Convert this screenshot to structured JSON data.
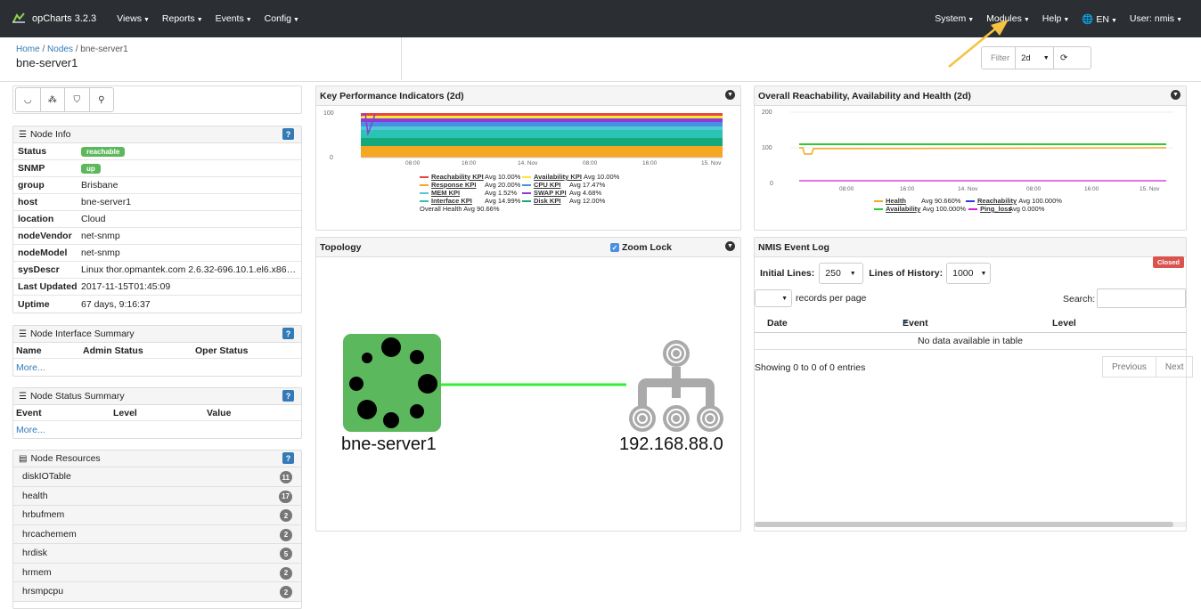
{
  "navbar": {
    "brand": "opCharts 3.2.3",
    "left_menus": [
      "Views",
      "Reports",
      "Events",
      "Config"
    ],
    "right_menus": [
      "System",
      "Modules",
      "Help",
      "EN",
      "User: nmis"
    ]
  },
  "breadcrumb": {
    "home": "Home",
    "nodes": "Nodes",
    "current": "bne-server1"
  },
  "page_title": "bne-server1",
  "filter": {
    "label": "Filter",
    "value": "2d"
  },
  "node_info": {
    "title": "Node Info",
    "help": "?",
    "rows": [
      {
        "key": "Status",
        "value": "reachable",
        "badge": true
      },
      {
        "key": "SNMP",
        "value": "up",
        "badge": true
      },
      {
        "key": "group",
        "value": "Brisbane"
      },
      {
        "key": "host",
        "value": "bne-server1"
      },
      {
        "key": "location",
        "value": "Cloud"
      },
      {
        "key": "nodeVendor",
        "value": "net-snmp"
      },
      {
        "key": "nodeModel",
        "value": "net-snmp"
      },
      {
        "key": "sysDescr",
        "value": "Linux thor.opmantek.com 2.6.32-696.10.1.el6.x86_..."
      },
      {
        "key": "Last Updated",
        "value": "2017-11-15T01:45:09"
      },
      {
        "key": "Uptime",
        "value": "67 days, 9:16:37"
      }
    ]
  },
  "interface_summary": {
    "title": "Node Interface Summary",
    "help": "?",
    "columns": [
      "Name",
      "Admin Status",
      "Oper Status"
    ],
    "more": "More..."
  },
  "status_summary": {
    "title": "Node Status Summary",
    "help": "?",
    "columns": [
      "Event",
      "Level",
      "Value"
    ],
    "more": "More..."
  },
  "resources": {
    "title": "Node Resources",
    "help": "?",
    "items": [
      {
        "name": "diskIOTable",
        "count": "11"
      },
      {
        "name": "health",
        "count": "17"
      },
      {
        "name": "hrbufmem",
        "count": "2"
      },
      {
        "name": "hrcachemem",
        "count": "2"
      },
      {
        "name": "hrdisk",
        "count": "5"
      },
      {
        "name": "hrmem",
        "count": "2"
      },
      {
        "name": "hrsmpcpu",
        "count": "2"
      }
    ]
  },
  "kpi": {
    "title": "Key Performance Indicators (2d)",
    "y_top": "100",
    "y_bottom": "0",
    "x_ticks": [
      "08:00",
      "16:00",
      "14. Nov",
      "08:00",
      "16:00",
      "15. Nov"
    ],
    "legend": [
      {
        "name": "Reachability KPI",
        "avg": "Avg 10.00%",
        "color": "#e8463e"
      },
      {
        "name": "Availability KPI",
        "avg": "Avg 10.00%",
        "color": "#f6e93b"
      },
      {
        "name": "Response KPI",
        "avg": "Avg 20.00%",
        "color": "#f5a623"
      },
      {
        "name": "CPU KPI",
        "avg": "Avg 17.47%",
        "color": "#4a90e2"
      },
      {
        "name": "MEM KPI",
        "avg": "Avg 1.52%",
        "color": "#50c8d6"
      },
      {
        "name": "SWAP KPI",
        "avg": "Avg 4.68%",
        "color": "#8e3ad6"
      },
      {
        "name": "Interface KPI",
        "avg": "Avg 14.99%",
        "color": "#2bc3b4"
      },
      {
        "name": "Disk KPI",
        "avg": "Avg 12.00%",
        "color": "#14a87a"
      }
    ],
    "overall": "Overall Health Avg 90.66%"
  },
  "health": {
    "title": "Overall Reachability, Availability and Health (2d)",
    "y_ticks": [
      "200",
      "100",
      "0"
    ],
    "x_ticks": [
      "08:00",
      "16:00",
      "14. Nov",
      "08:00",
      "16:00",
      "15. Nov"
    ],
    "legend": [
      {
        "name": "Health",
        "avg": "Avg 90.660%",
        "color": "#f5a623"
      },
      {
        "name": "Reachability",
        "avg": "Avg 100.000%",
        "color": "#2a3de0"
      },
      {
        "name": "Availability",
        "avg": "Avg 100.000%",
        "color": "#2dc92d"
      },
      {
        "name": "Ping_loss",
        "avg": "Avg 0.000%",
        "color": "#d61fd6"
      }
    ]
  },
  "topology": {
    "title": "Topology",
    "zoom_lock": "Zoom Lock",
    "node_label": "bne-server1",
    "network_label": "192.168.88.0"
  },
  "event_log": {
    "title": "NMIS Event Log",
    "closed": "Closed",
    "initial_lines_label": "Initial Lines:",
    "initial_lines": "250",
    "history_label": "Lines of History:",
    "history": "1000",
    "records_per_page": "records per page",
    "search_label": "Search:",
    "columns": [
      "Date",
      "Event",
      "Level"
    ],
    "empty": "No data available in table",
    "showing": "Showing 0 to 0 of 0 entries",
    "prev": "Previous",
    "next": "Next"
  },
  "colors": {
    "navbar": "#2b2f33",
    "green": "#5cb85c",
    "link": "#337ab7",
    "annotation_arrow": "#f5c242"
  }
}
